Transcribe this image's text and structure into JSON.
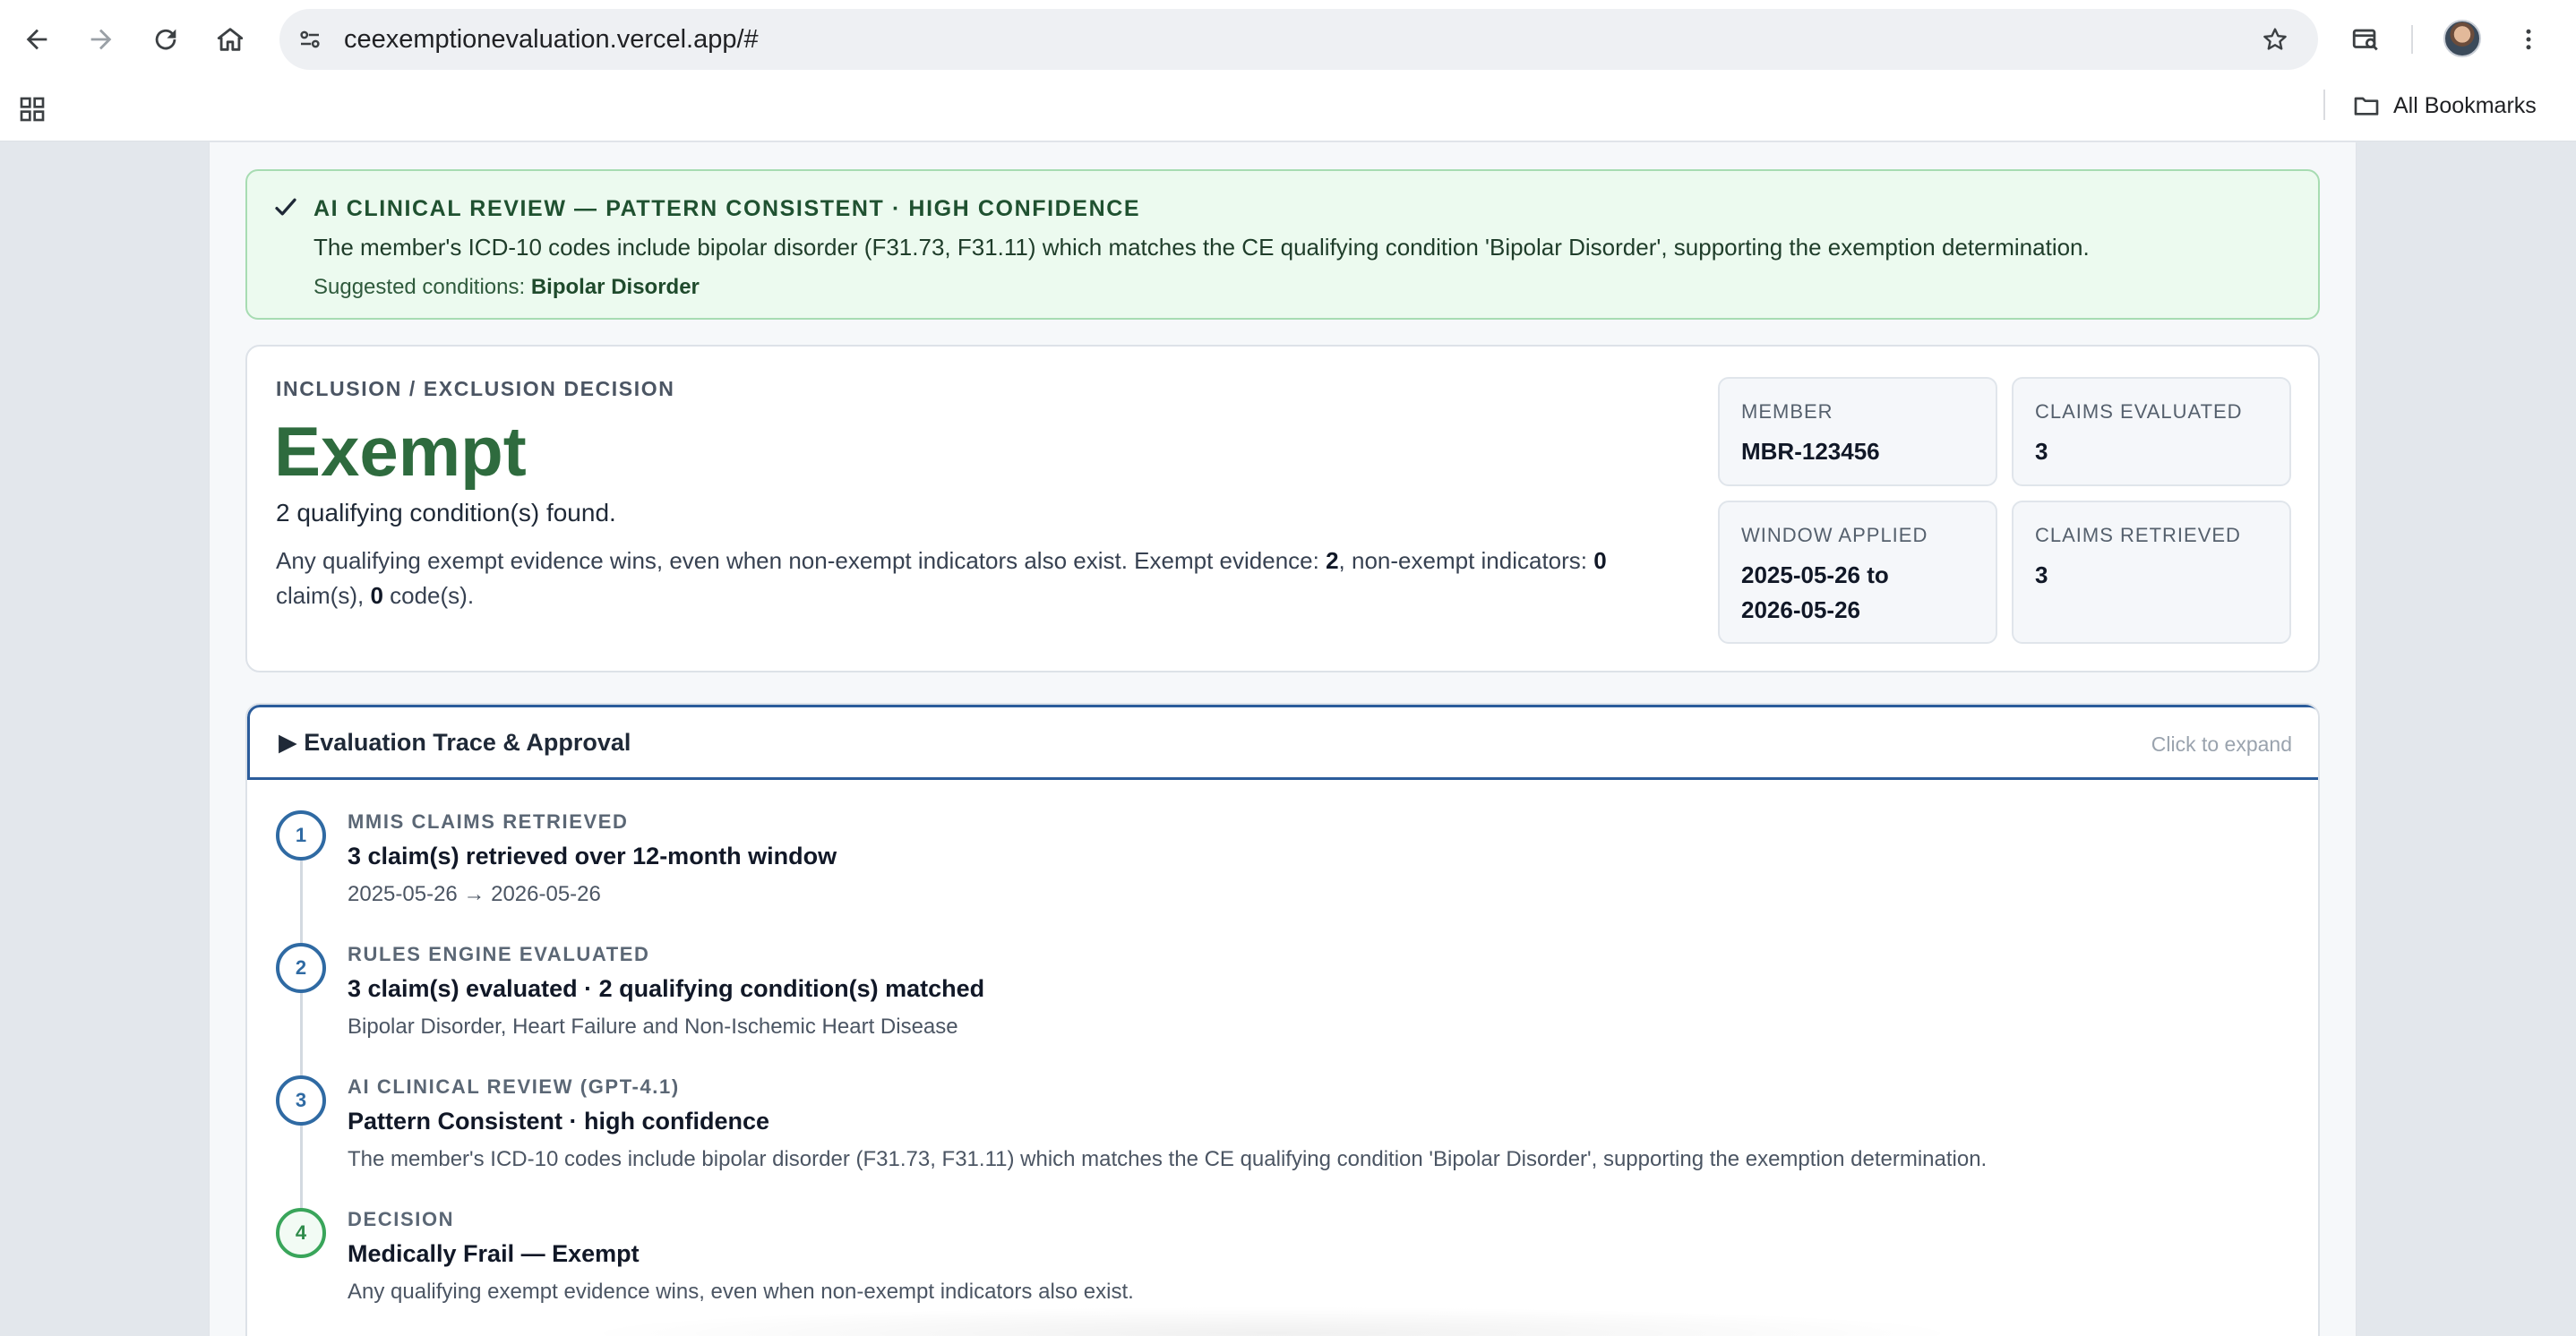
{
  "browser": {
    "url": "ceexemptionevaluation.vercel.app/#",
    "bookmarks_label": "All Bookmarks",
    "icons": [
      "back-icon",
      "forward-icon",
      "reload-icon",
      "home-icon",
      "site-settings-icon",
      "star-icon",
      "tab-search-icon",
      "profile-avatar",
      "more-icon",
      "apps-grid-icon",
      "folder-icon"
    ]
  },
  "ai_review": {
    "title": "AI CLINICAL REVIEW — PATTERN CONSISTENT · HIGH CONFIDENCE",
    "body": "The member's ICD-10 codes include bipolar disorder (F31.73, F31.11) which matches the CE qualifying condition 'Bipolar Disorder', supporting the exemption determination.",
    "suggested_label": "Suggested conditions:",
    "suggested_value": "Bipolar Disorder",
    "colors": {
      "background": "#ecfaef",
      "border": "#a7dcb2",
      "text": "#1f5130"
    }
  },
  "decision": {
    "eyebrow": "INCLUSION / EXCLUSION DECISION",
    "verdict": "Exempt",
    "found": "2 qualifying condition(s) found.",
    "explain_prefix": "Any qualifying exempt evidence wins, even when non-exempt indicators also exist. Exempt evidence: ",
    "exempt_evidence": "2",
    "explain_mid": ", non-exempt indicators: ",
    "non_exempt_claims": "0",
    "explain_claims": " claim(s), ",
    "non_exempt_codes": "0",
    "explain_suffix": " code(s).",
    "verdict_color": "#2e6b3e",
    "stats": {
      "member": {
        "label": "MEMBER",
        "value": "MBR-123456"
      },
      "claims_evaluated": {
        "label": "CLAIMS EVALUATED",
        "value": "3"
      },
      "window_applied": {
        "label": "WINDOW APPLIED",
        "value_line1": "2025-05-26 to",
        "value_line2": "2026-05-26"
      },
      "claims_retrieved": {
        "label": "CLAIMS RETRIEVED",
        "value": "3"
      }
    }
  },
  "trace": {
    "toggle": "▶",
    "title": "Evaluation Trace & Approval",
    "hint": "Click to expand",
    "steps": [
      {
        "num": "1",
        "label": "MMIS CLAIMS RETRIEVED",
        "headline": "3 claim(s) retrieved over 12-month window",
        "detail": "2025-05-26 → 2026-05-26"
      },
      {
        "num": "2",
        "label": "RULES ENGINE EVALUATED",
        "headline": "3 claim(s) evaluated · 2 qualifying condition(s) matched",
        "detail": "Bipolar Disorder, Heart Failure and Non-Ischemic Heart Disease"
      },
      {
        "num": "3",
        "label": "AI CLINICAL REVIEW (GPT-4.1)",
        "headline": "Pattern Consistent · high confidence",
        "detail": "The member's ICD-10 codes include bipolar disorder (F31.73, F31.11) which matches the CE qualifying condition 'Bipolar Disorder', supporting the exemption determination."
      },
      {
        "num": "4",
        "label": "DECISION",
        "headline": "Medically Frail — Exempt",
        "detail": "Any qualifying exempt evidence wins, even when non-exempt indicators also exist."
      }
    ],
    "accent": "#2b5c9b",
    "final_step_color": "#39a55a"
  }
}
